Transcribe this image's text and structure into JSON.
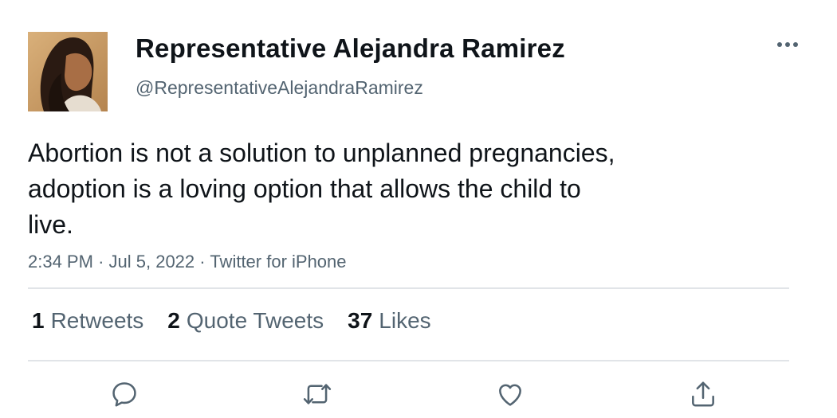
{
  "author": {
    "display_name": "Representative Alejandra Ramirez",
    "handle": "@RepresentativeAlejandraRamirez"
  },
  "tweet": {
    "text_lines": [
      "Abortion is not a solution to unplanned pregnancies,",
      "adoption is a loving option that allows the child to",
      "live."
    ],
    "time": "2:34 PM",
    "date": "Jul 5, 2022",
    "source": "Twitter for iPhone",
    "separator": "·"
  },
  "stats": {
    "retweets_count": "1",
    "retweets_label": "Retweets",
    "quotes_count": "2",
    "quotes_label": "Quote Tweets",
    "likes_count": "37",
    "likes_label": "Likes"
  },
  "icons": {
    "more": "more-horizontal-icon",
    "reply": "reply-icon",
    "retweet": "retweet-icon",
    "like": "heart-icon",
    "share": "share-icon"
  },
  "colors": {
    "text": "#0f1419",
    "secondary": "#536471",
    "divider": "#e1e4e8"
  }
}
